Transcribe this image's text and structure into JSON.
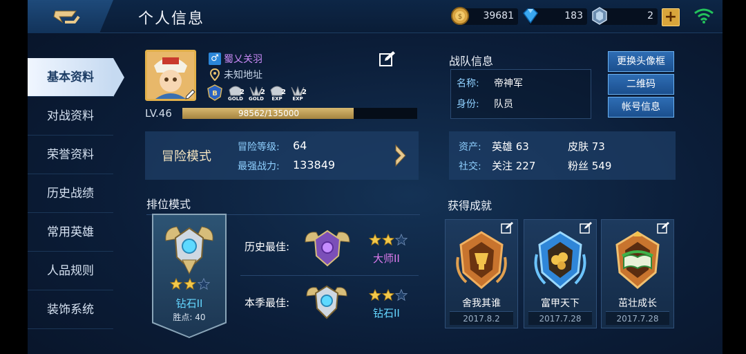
{
  "header": {
    "title": "个人信息",
    "coins": "39681",
    "diamonds": "183",
    "tickets": "2",
    "plus_label": "+"
  },
  "sidebar": {
    "items": [
      {
        "label": "基本资料",
        "active": true
      },
      {
        "label": "对战资料"
      },
      {
        "label": "荣誉资料"
      },
      {
        "label": "历史战绩"
      },
      {
        "label": "常用英雄"
      },
      {
        "label": "人品规则"
      },
      {
        "label": "装饰系统"
      }
    ]
  },
  "profile": {
    "gender_symbol": "♂",
    "name": "蜀乂关羽",
    "location": "未知地址",
    "badges": [
      "GOLD",
      "GOLD",
      "EXP",
      "EXP"
    ],
    "level": "LV.46",
    "xp_text": "98562/135000",
    "xp_fraction": 0.73
  },
  "adventure": {
    "title": "冒险模式",
    "level_label": "冒险等级:",
    "level_value": "64",
    "power_label": "最强战力:",
    "power_value": "133849"
  },
  "ranked": {
    "title": "排位模式",
    "current_rank": "钻石II",
    "points_label": "胜点:",
    "points_value": "40",
    "current_stars": 2,
    "history_label": "历史最佳:",
    "history_rank": "大师II",
    "history_stars": 2,
    "season_label": "本季最佳:",
    "season_rank": "钻石II",
    "season_stars": 2
  },
  "team": {
    "title": "战队信息",
    "name_label": "名称:",
    "name_value": "帝神军",
    "role_label": "身份:",
    "role_value": "队员"
  },
  "actions": {
    "change_frame": "更换头像框",
    "qr_code": "二维码",
    "account_info": "帐号信息"
  },
  "stats": {
    "assets_label": "资产:",
    "heroes": "英雄 63",
    "skins": "皮肤 73",
    "social_label": "社交:",
    "following": "关注 227",
    "fans": "粉丝 549"
  },
  "achievements": {
    "title": "获得成就",
    "items": [
      {
        "name": "舍我其谁",
        "date": "2017.8.2"
      },
      {
        "name": "富甲天下",
        "date": "2017.7.28"
      },
      {
        "name": "茁壮成长",
        "date": "2017.7.28"
      }
    ]
  },
  "colors": {
    "accent_blue": "#64d6ff",
    "master_purple": "#e07cf0",
    "gold": "#e2b04a",
    "button_blue": "#2e6db4"
  }
}
